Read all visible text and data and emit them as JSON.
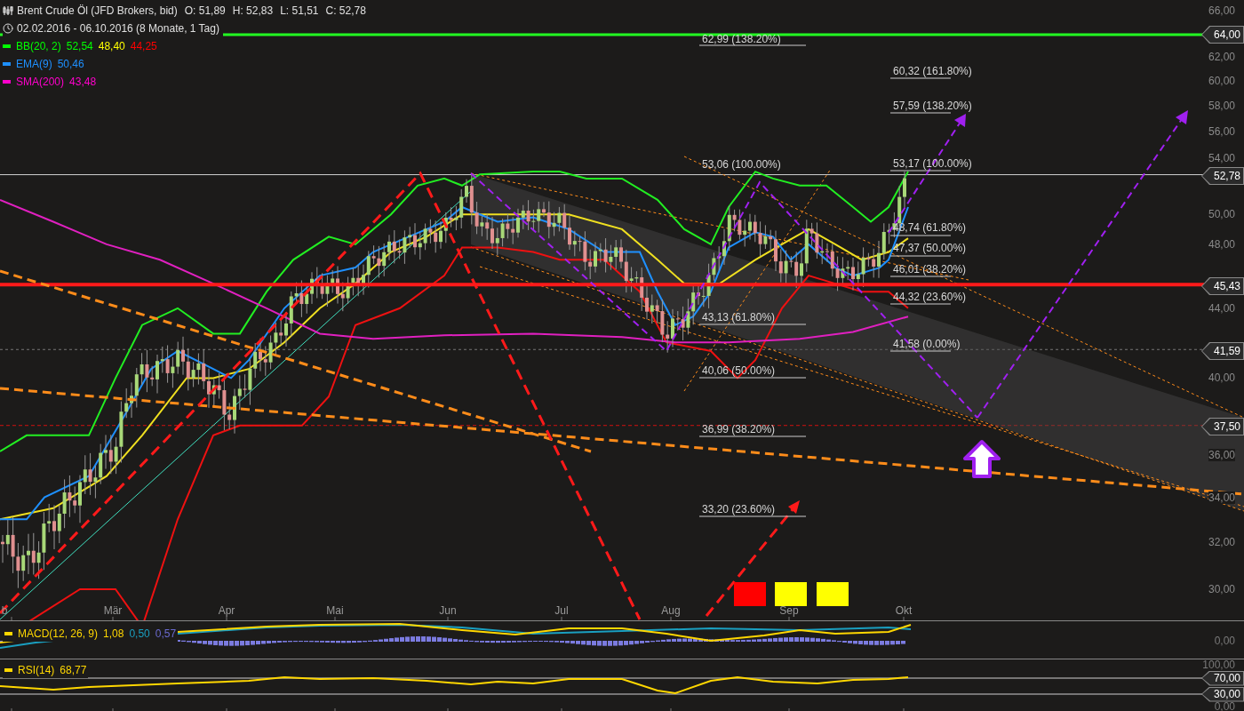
{
  "header": {
    "title": "Brent Crude Öl (JFD Brokers, bid)",
    "ohlc": [
      "O: 51,89",
      "H: 52,83",
      "L: 51,51",
      "C: 52,78"
    ],
    "range": "02.02.2016 - 06.10.2016 (8 Monate, 1 Tag)"
  },
  "indicators": [
    {
      "name": "BB(20, 2)",
      "color": "#00ff00",
      "values": [
        {
          "text": "52,54",
          "color": "#00ff00"
        },
        {
          "text": "48,40",
          "color": "#ffff00"
        },
        {
          "text": "44,25",
          "color": "#ff0000"
        }
      ]
    },
    {
      "name": "EMA(9)",
      "color": "#1e90ff",
      "values": [
        {
          "text": "50,46",
          "color": "#1e90ff"
        }
      ]
    },
    {
      "name": "SMA(200)",
      "color": "#ff00cc",
      "values": [
        {
          "text": "43,48",
          "color": "#ff00cc"
        }
      ]
    }
  ],
  "price_axis": {
    "ticks": [
      "66,00",
      "62,00",
      "60,00",
      "58,00",
      "56,00",
      "54,00",
      "50,00",
      "48,00",
      "44,00",
      "40,00",
      "36,00",
      "34,00",
      "32,00",
      "30,00"
    ],
    "tags": [
      "64,00",
      "52,78",
      "45,43",
      "41,59",
      "37,50"
    ]
  },
  "fib_left": [
    "62,99 (138.20%)",
    "53,06 (100.00%)",
    "43,13 (61.80%)",
    "40,06 (50.00%)",
    "36,99 (38.20%)",
    "33,20 (23.60%)"
  ],
  "fib_right": [
    "60,32 (161.80%)",
    "57,59 (138.20%)",
    "53,17 (100.00%)",
    "48,74 (61.80%)",
    "47,37 (50.00%)",
    "46,01 (38.20%)",
    "44,32 (23.60%)",
    "41,58 (0.00%)"
  ],
  "months": [
    "b",
    "Mär",
    "Apr",
    "Mai",
    "Jun",
    "Jul",
    "Aug",
    "Sep",
    "Okt"
  ],
  "signal_boxes": [
    {
      "color": "#ff0000"
    },
    {
      "color": "#ffff00"
    },
    {
      "color": "#ffff00"
    }
  ],
  "macd": {
    "label": "MACD(12, 26, 9)",
    "values": [
      {
        "text": "1,08",
        "color": "#ffd700"
      },
      {
        "text": "0,50",
        "color": "#1a9fc0"
      },
      {
        "text": "0,57",
        "color": "#6a6ad0"
      }
    ],
    "axis": [
      "0,00"
    ]
  },
  "rsi": {
    "label": "RSI(14)",
    "value": "68,77",
    "axis": [
      "100,00",
      "0,00"
    ],
    "tags": [
      "70,00",
      "30,00"
    ]
  }
}
